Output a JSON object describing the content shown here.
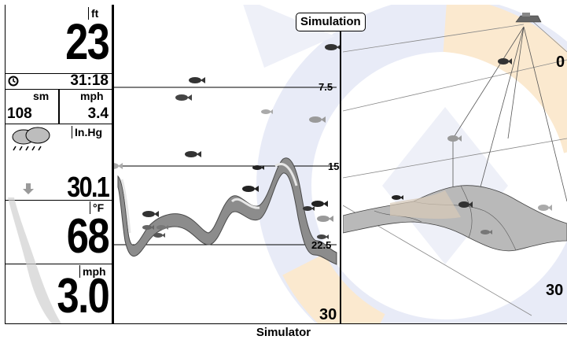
{
  "panel": {
    "depth_unit": "ft",
    "depth_value": "23",
    "timer": "31:18",
    "dist_unit": "sm",
    "speed_unit_small": "mph",
    "dist_value": "108",
    "speed_value_small": "3.4",
    "pressure_unit": "In.Hg",
    "pressure_value": "30.1",
    "temp_unit": "°F",
    "temp_value": "68",
    "speed_unit": "mph",
    "speed_value": "3.0"
  },
  "sonar": {
    "depth_labels": [
      "7.5",
      "15",
      "22.5"
    ],
    "bottom_depth": "30"
  },
  "view3d": {
    "depth_top": "0",
    "depth_bottom": "30"
  },
  "mode_tag": "Simulation",
  "caption": "Simulator",
  "icons": [
    "clock-icon",
    "weather-cloud-icon",
    "pressure-down-arrow-icon",
    "fish-icon",
    "boat-icon"
  ],
  "colors": {
    "watermark_blue": "#e6e9f6",
    "watermark_orange": "#fbe9cf",
    "bottom_gray": "#8a8a8a",
    "fish_dark": "#222222",
    "fish_light": "#9a9a9a"
  }
}
